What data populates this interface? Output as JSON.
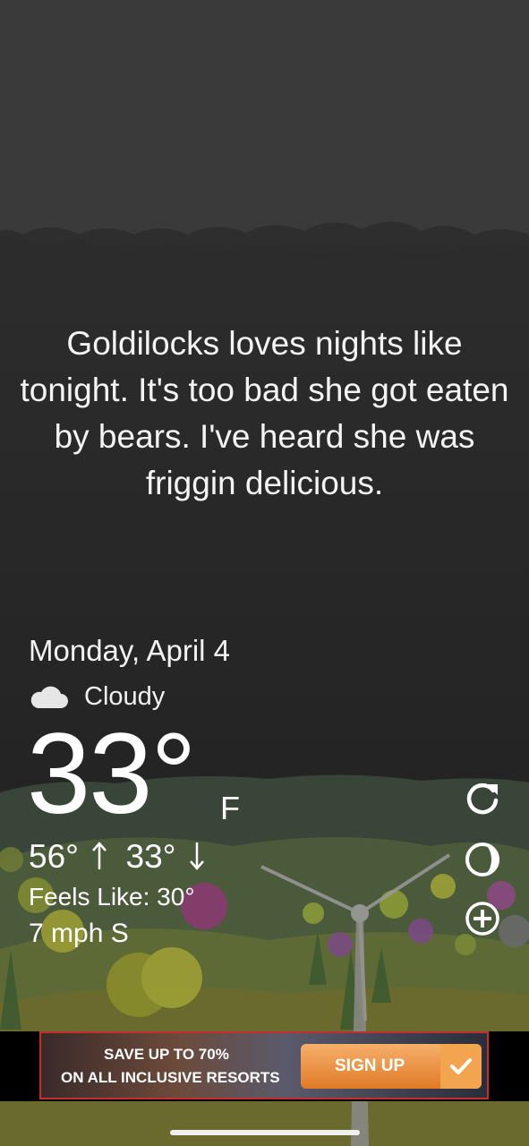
{
  "quote": "Goldilocks loves nights like tonight. It's too bad she got eaten by bears. I've heard she was friggin delicious.",
  "weather": {
    "date": "Monday, April 4",
    "condition": "Cloudy",
    "condition_icon": "cloud-icon",
    "temperature": "33°",
    "unit": "F",
    "high": "56°",
    "low": "33°",
    "feels_like": "Feels Like: 30°",
    "wind": "7 mph S"
  },
  "actions": {
    "refresh_icon": "refresh-icon",
    "theme_icon": "moon-phase-icon",
    "add_icon": "add-location-icon"
  },
  "ad": {
    "line1": "SAVE UP TO 70%",
    "line2": "ON ALL INCLUSIVE RESORTS",
    "cta": "SIGN UP",
    "border_color": "#c62d2d",
    "cta_color": "#e88a36"
  },
  "colors": {
    "sky": "#202020",
    "clouds": "#3a3a3a",
    "hills": "#3d4a3e"
  }
}
